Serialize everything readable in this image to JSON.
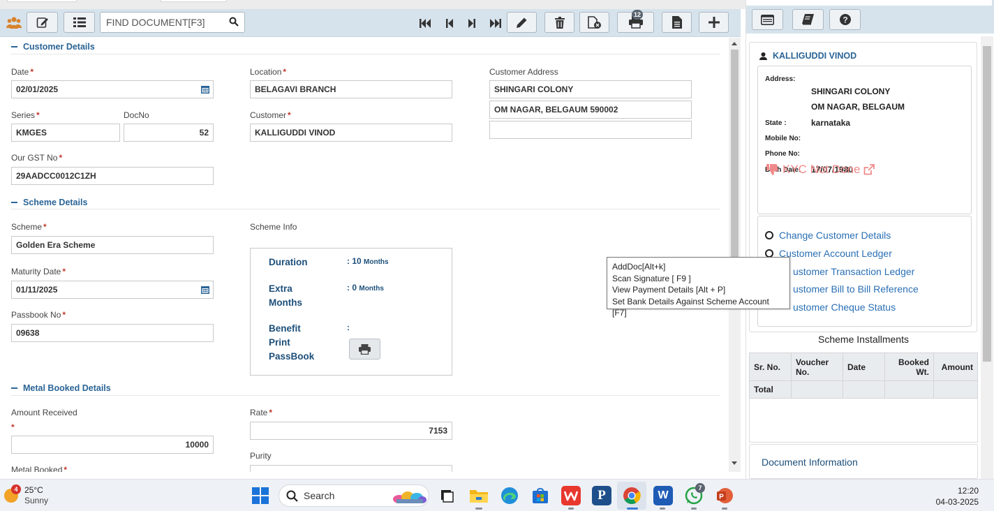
{
  "toolbar": {
    "search_placeholder": "FIND DOCUMENT[F3]",
    "badge_count": "12"
  },
  "customer_details": {
    "heading": "Customer Details",
    "date_label": "Date",
    "date_value": "02/01/2025",
    "location_label": "Location",
    "location_value": "BELAGAVI BRANCH",
    "address_label": "Customer Address",
    "address_line1": "SHINGARI COLONY",
    "address_line2": "OM NAGAR, BELGAUM 590002",
    "address_line3": "",
    "series_label": "Series",
    "series_value": "KMGES",
    "docno_label": "DocNo",
    "docno_value": "52",
    "customer_label": "Customer",
    "customer_value": "KALLIGUDDI VINOD",
    "gst_label": "Our GST No",
    "gst_value": "29AADCC0012C1ZH"
  },
  "scheme_details": {
    "heading": "Scheme Details",
    "scheme_label": "Scheme",
    "scheme_value": "Golden Era Scheme",
    "scheme_info_label": "Scheme Info",
    "maturity_label": "Maturity Date",
    "maturity_value": "01/11/2025",
    "passbook_label": "Passbook No",
    "passbook_value": "09638",
    "info": {
      "duration_label": "Duration",
      "duration_value": ": 10",
      "duration_unit": "Months",
      "extra_label_1": "Extra",
      "extra_label_2": "Months",
      "extra_value": ": 0",
      "extra_unit": "Months",
      "benefit_label_1": "Benefit",
      "benefit_label_2": "Print",
      "benefit_label_3": "PassBook",
      "benefit_value": ":"
    }
  },
  "metal_booked": {
    "heading": "Metal Booked Details",
    "amount_label": "Amount Received",
    "amount_value": "10000",
    "rate_label": "Rate",
    "rate_value": "7153",
    "purity_label": "Purity",
    "metal_label": "Metal Booked"
  },
  "tooltip": {
    "line1": "AddDoc[Alt+k]",
    "line2": "Scan Signature [ F9 ]",
    "line3": "View Payment Details [Alt + P]",
    "line4": "Set Bank Details Against Scheme Account [F7]"
  },
  "customer_card": {
    "name": "KALLIGUDDI VINOD",
    "address_label": "Address:",
    "address_line1": "SHINGARI COLONY",
    "address_line2": "OM NAGAR, BELGAUM",
    "state_label": "State :",
    "state_value": "karnataka",
    "mobile_label": "Mobile No:",
    "phone_label": "Phone No:",
    "birth_label": "Birth Date:",
    "birth_value": "17/07/1980",
    "kyc_text": "KYC Not Done",
    "links": [
      "Change Customer Details",
      "Customer Account Ledger",
      "ustomer Transaction Ledger",
      "ustomer Bill to Bill Reference",
      "ustomer Cheque Status"
    ]
  },
  "installments": {
    "title": "Scheme Installments",
    "columns": [
      "Sr. No.",
      "Voucher No.",
      "Date",
      "Booked Wt.",
      "Amount"
    ],
    "total_label": "Total"
  },
  "document_info": {
    "title": "Document Information"
  },
  "taskbar": {
    "temperature": "25°C",
    "weather": "Sunny",
    "weather_badge": "4",
    "search_label": "Search",
    "whatsapp_badge": "7",
    "time": "12:20",
    "date": "04-03-2025"
  }
}
